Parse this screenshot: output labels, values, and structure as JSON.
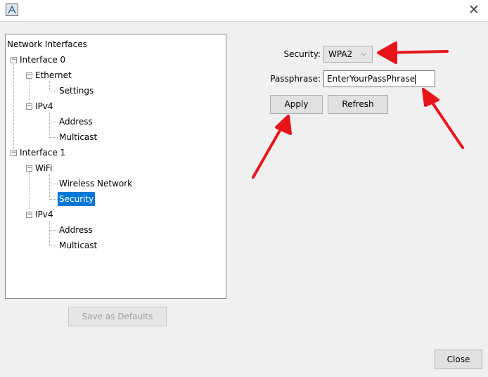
{
  "window": {
    "close_glyph": "✕",
    "icon": "app-icon"
  },
  "tree": {
    "root": "Network Interfaces",
    "interface0": "Interface 0",
    "ethernet": "Ethernet",
    "eth_settings": "Settings",
    "ipv4_0": "IPv4",
    "addr_0": "Address",
    "mcast_0": "Multicast",
    "interface1": "Interface 1",
    "wifi": "WiFi",
    "wireless_network": "Wireless Network",
    "security": "Security",
    "ipv4_1": "IPv4",
    "addr_1": "Address",
    "mcast_1": "Multicast"
  },
  "form": {
    "security_label": "Security:",
    "security_value": "WPA2",
    "passphrase_label": "Passphrase:",
    "passphrase_value": "EnterYourPassPhrase",
    "apply": "Apply",
    "refresh": "Refresh"
  },
  "buttons": {
    "save_defaults": "Save as Defaults",
    "close": "Close"
  },
  "colors": {
    "selection": "#0078d7",
    "annotation_arrow": "#e8141b"
  }
}
